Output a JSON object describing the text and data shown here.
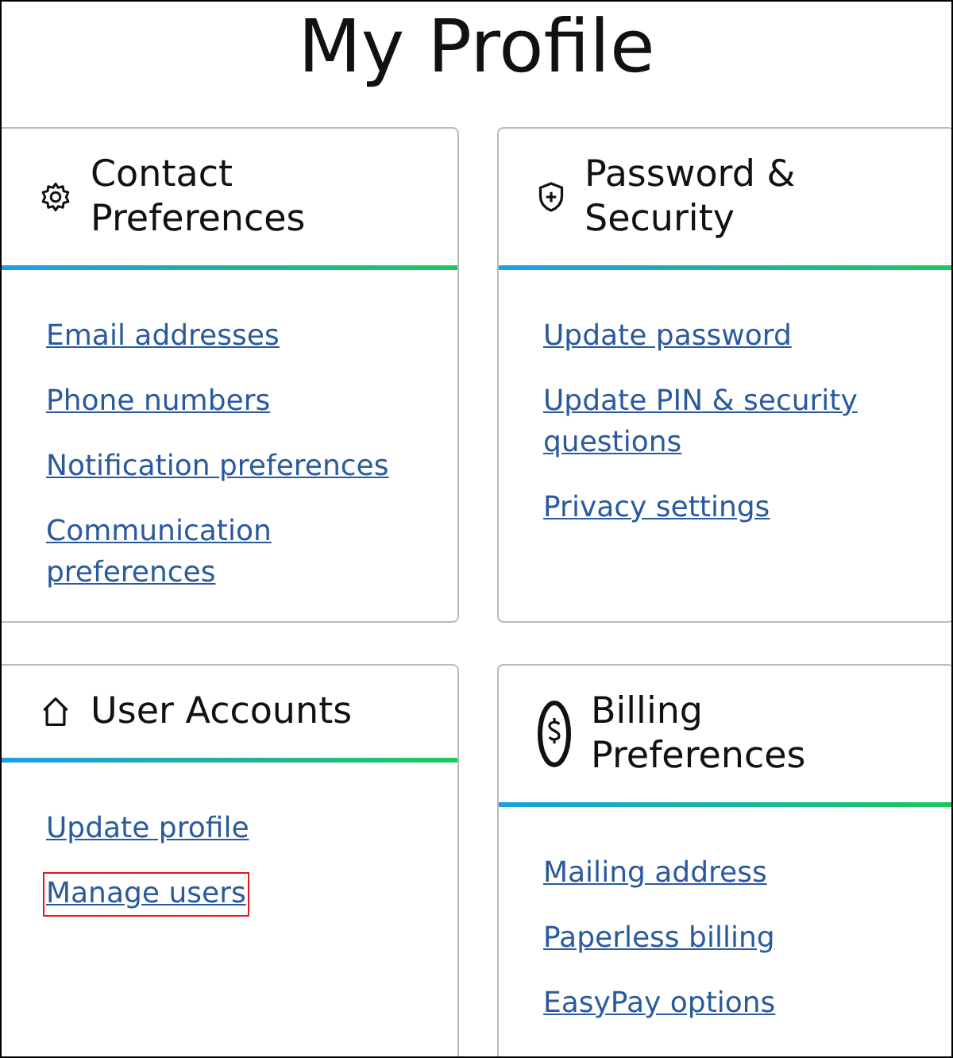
{
  "title": "My Profile",
  "cards": [
    {
      "kind": "gear",
      "title": "Contact Preferences",
      "links": [
        {
          "label": "Email addresses",
          "highlighted": false
        },
        {
          "label": "Phone numbers",
          "highlighted": false
        },
        {
          "label": "Notification preferences",
          "highlighted": false
        },
        {
          "label": "Communication preferences",
          "highlighted": false
        }
      ]
    },
    {
      "kind": "shield",
      "title": "Password & Security",
      "links": [
        {
          "label": "Update password",
          "highlighted": false
        },
        {
          "label": "Update PIN & security questions",
          "highlighted": false
        },
        {
          "label": "Privacy settings",
          "highlighted": false
        }
      ]
    },
    {
      "kind": "house",
      "title": "User Accounts",
      "links": [
        {
          "label": "Update profile",
          "highlighted": false
        },
        {
          "label": "Manage users",
          "highlighted": true
        }
      ]
    },
    {
      "kind": "dollar",
      "title": "Billing Preferences",
      "links": [
        {
          "label": "Mailing address",
          "highlighted": false
        },
        {
          "label": "Paperless billing",
          "highlighted": false
        },
        {
          "label": "EasyPay options",
          "highlighted": false
        }
      ]
    }
  ]
}
